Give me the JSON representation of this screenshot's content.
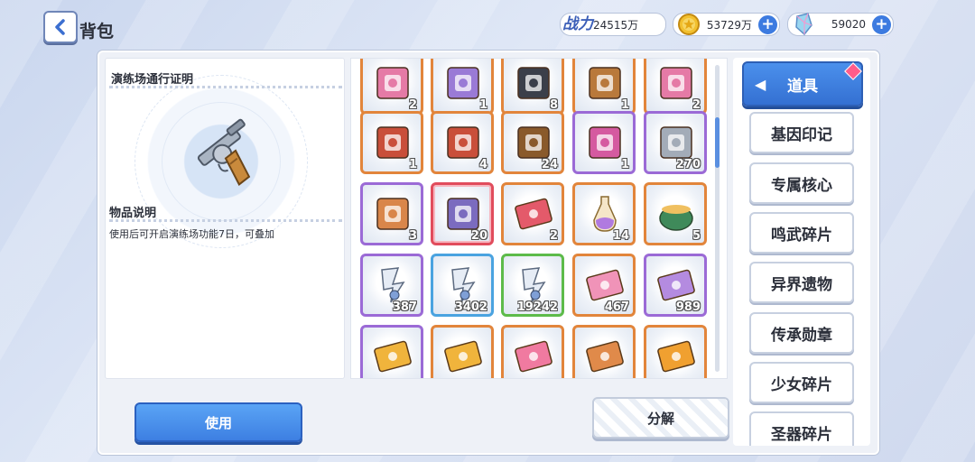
{
  "header": {
    "title": "背包",
    "power_label": "战力",
    "power_value": "24515万",
    "coins": "53729万",
    "gems": "59020"
  },
  "detail": {
    "item_name": "演练场通行证明",
    "desc_title": "物品说明",
    "desc_text": "使用后可开启演练场功能7日，可叠加"
  },
  "grid": {
    "rows": [
      [
        {
          "icon": "pink-crate-icon",
          "rarity": "orange",
          "count": "2"
        },
        {
          "icon": "purple-crate-icon",
          "rarity": "orange",
          "count": "1"
        },
        {
          "icon": "dark-crate-icon",
          "rarity": "orange",
          "count": "8"
        },
        {
          "icon": "brown-crate-icon",
          "rarity": "orange",
          "count": "1"
        },
        {
          "icon": "pink-crate-icon",
          "rarity": "orange",
          "count": "2"
        }
      ],
      [
        {
          "icon": "smiley-box-icon",
          "rarity": "orange",
          "count": "1"
        },
        {
          "icon": "smiley-box-icon",
          "rarity": "orange",
          "count": "4"
        },
        {
          "icon": "wood-chest-icon",
          "rarity": "orange",
          "count": "24"
        },
        {
          "icon": "flower-box-icon",
          "rarity": "purple",
          "count": "1"
        },
        {
          "icon": "silver-chest-icon",
          "rarity": "purple",
          "count": "270"
        }
      ],
      [
        {
          "icon": "orange-crate-icon",
          "rarity": "purple",
          "count": "3"
        },
        {
          "icon": "gear-crate-icon",
          "rarity": "red",
          "count": "20"
        },
        {
          "icon": "red-ticket-icon",
          "rarity": "orange",
          "count": "2"
        },
        {
          "icon": "potion-bottle-icon",
          "rarity": "orange",
          "count": "14"
        },
        {
          "icon": "cauldron-icon",
          "rarity": "orange",
          "count": "5"
        }
      ],
      [
        {
          "icon": "crystal-shard-icon",
          "rarity": "purple",
          "count": "387"
        },
        {
          "icon": "crystal-shard-icon",
          "rarity": "blue",
          "count": "3402"
        },
        {
          "icon": "crystal-shard-icon",
          "rarity": "green",
          "count": "19242"
        },
        {
          "icon": "pink-ticket-icon",
          "rarity": "orange",
          "count": "467"
        },
        {
          "icon": "purple-ticket-icon",
          "rarity": "purple",
          "count": "989"
        }
      ],
      [
        {
          "icon": "gold-card-icon",
          "rarity": "purple",
          "count": ""
        },
        {
          "icon": "gold-card-icon",
          "rarity": "orange",
          "count": ""
        },
        {
          "icon": "pink-card-icon",
          "rarity": "orange",
          "count": ""
        },
        {
          "icon": "rainbow-ticket-icon",
          "rarity": "orange",
          "count": ""
        },
        {
          "icon": "sword-card-icon",
          "rarity": "orange",
          "count": ""
        }
      ]
    ]
  },
  "tabs": [
    {
      "label": "道具",
      "active": true
    },
    {
      "label": "基因印记"
    },
    {
      "label": "专属核心"
    },
    {
      "label": "鸣武碎片"
    },
    {
      "label": "异界遗物"
    },
    {
      "label": "传承勋章"
    },
    {
      "label": "少女碎片"
    },
    {
      "label": "圣器碎片"
    }
  ],
  "buttons": {
    "use": "使用",
    "decompose": "分解"
  }
}
